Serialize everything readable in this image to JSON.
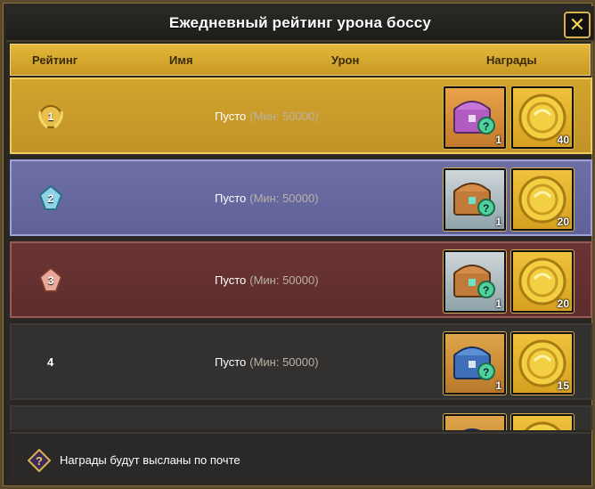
{
  "window": {
    "title": "Ежедневный рейтинг урона боссу",
    "close_label": "✕"
  },
  "header": {
    "rank": "Рейтинг",
    "name": "Имя",
    "damage": "Урон",
    "rewards": "Награды"
  },
  "rows": [
    {
      "rank": "1",
      "name": "Пусто",
      "min": "(Мин: 50000)",
      "chest_count": "1",
      "coin_count": "40"
    },
    {
      "rank": "2",
      "name": "Пусто",
      "min": "(Мин: 50000)",
      "chest_count": "1",
      "coin_count": "20"
    },
    {
      "rank": "3",
      "name": "Пусто",
      "min": "(Мин: 50000)",
      "chest_count": "1",
      "coin_count": "20"
    },
    {
      "rank": "4",
      "name": "Пусто",
      "min": "(Мин: 50000)",
      "chest_count": "1",
      "coin_count": "15"
    }
  ],
  "footer": {
    "note": "Награды будут высланы по почте",
    "icon": "question-icon"
  },
  "colors": {
    "gold_row": "#c99a24",
    "silver_row": "#6567a0",
    "bronze_row": "#632f2f",
    "dark_row": "#333130",
    "accent": "#e2b73a"
  }
}
